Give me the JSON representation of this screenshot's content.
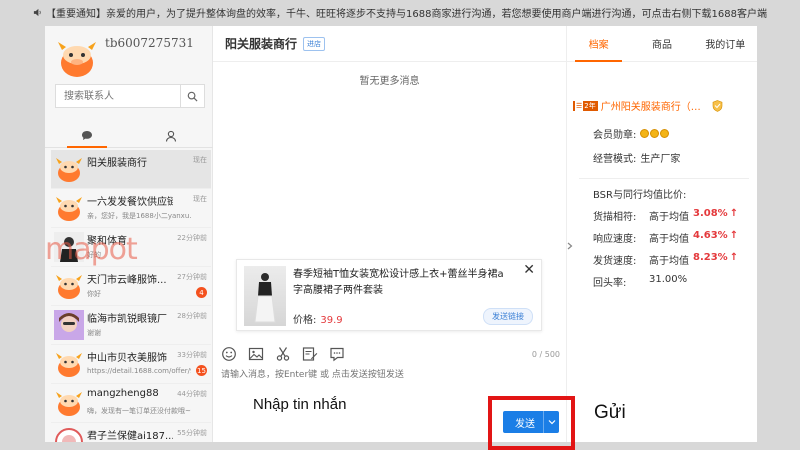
{
  "notice": {
    "text": "【重要通知】亲爱的用户，为了提升整体询盘的效率，千牛、旺旺将逐步不支持与1688商家进行沟通，若您想要使用商户端进行沟通，可点击右侧下载1688客户端"
  },
  "user": {
    "name": "tb6007275731"
  },
  "search": {
    "placeholder": "搜索联系人"
  },
  "contacts": [
    {
      "name": "阳关服装商行",
      "time": "现在",
      "preview": "",
      "badge": ""
    },
    {
      "name": "一六发发餐饮供应链",
      "time": "现在",
      "preview": "亲，您好，我是1688小二yanxu...",
      "badge": ""
    },
    {
      "name": "聚和体育",
      "time": "22分钟前",
      "preview": "好的",
      "badge": ""
    },
    {
      "name": "天门市云峰服饰...",
      "time": "27分钟前",
      "preview": "你好",
      "badge": "4"
    },
    {
      "name": "临海市凯锐眼镜厂",
      "time": "28分钟前",
      "preview": "谢谢",
      "badge": ""
    },
    {
      "name": "中山市贝衣美服饰",
      "time": "33分钟前",
      "preview": "https://detail.1688.com/offer/9...",
      "badge": "15"
    },
    {
      "name": "mangzheng88",
      "time": "44分钟前",
      "preview": "嗨，发现有一笔订单还没付款哦~",
      "badge": ""
    },
    {
      "name": "君子兰保健ai187...",
      "time": "55分钟前",
      "preview": "",
      "badge": ""
    }
  ],
  "chat": {
    "title": "阳关服装商行",
    "tag": "进店",
    "no_more": "暂无更多消息",
    "product": {
      "title": "春季短袖T恤女装宽松设计感上衣+蕾丝半身裙a字高腰裙子两件套装",
      "price_label": "价格:",
      "price": "39.9",
      "link_label": "发送链接",
      "close": "✕"
    },
    "char_count": "0 / 500",
    "input_placeholder": "请输入消息，按Enter键 或 点击发送按钮发送",
    "send_label": "发送"
  },
  "right_tabs": [
    "档案",
    "商品",
    "我的订单"
  ],
  "profile": {
    "years": "2年",
    "shop_name": "广州阳关服装商行（个...",
    "medal_label": "会员勋章:",
    "mode_label": "经营模式:",
    "mode_value": "生产厂家",
    "bsr_title": "BSR与同行均值比价:",
    "bsr": [
      {
        "label": "货描相符:",
        "desc": "高于均值",
        "value": "3.08%",
        "arrow": "↑"
      },
      {
        "label": "响应速度:",
        "desc": "高于均值",
        "value": "4.63%",
        "arrow": "↑"
      },
      {
        "label": "发货速度:",
        "desc": "高于均值",
        "value": "8.23%",
        "arrow": "↑"
      }
    ],
    "return_label": "回头率:",
    "return_value": "31.00%"
  },
  "overlay": {
    "watermark": "mapot",
    "caption_input": "Nhập tin nhắn",
    "caption_send": "Gửi"
  }
}
